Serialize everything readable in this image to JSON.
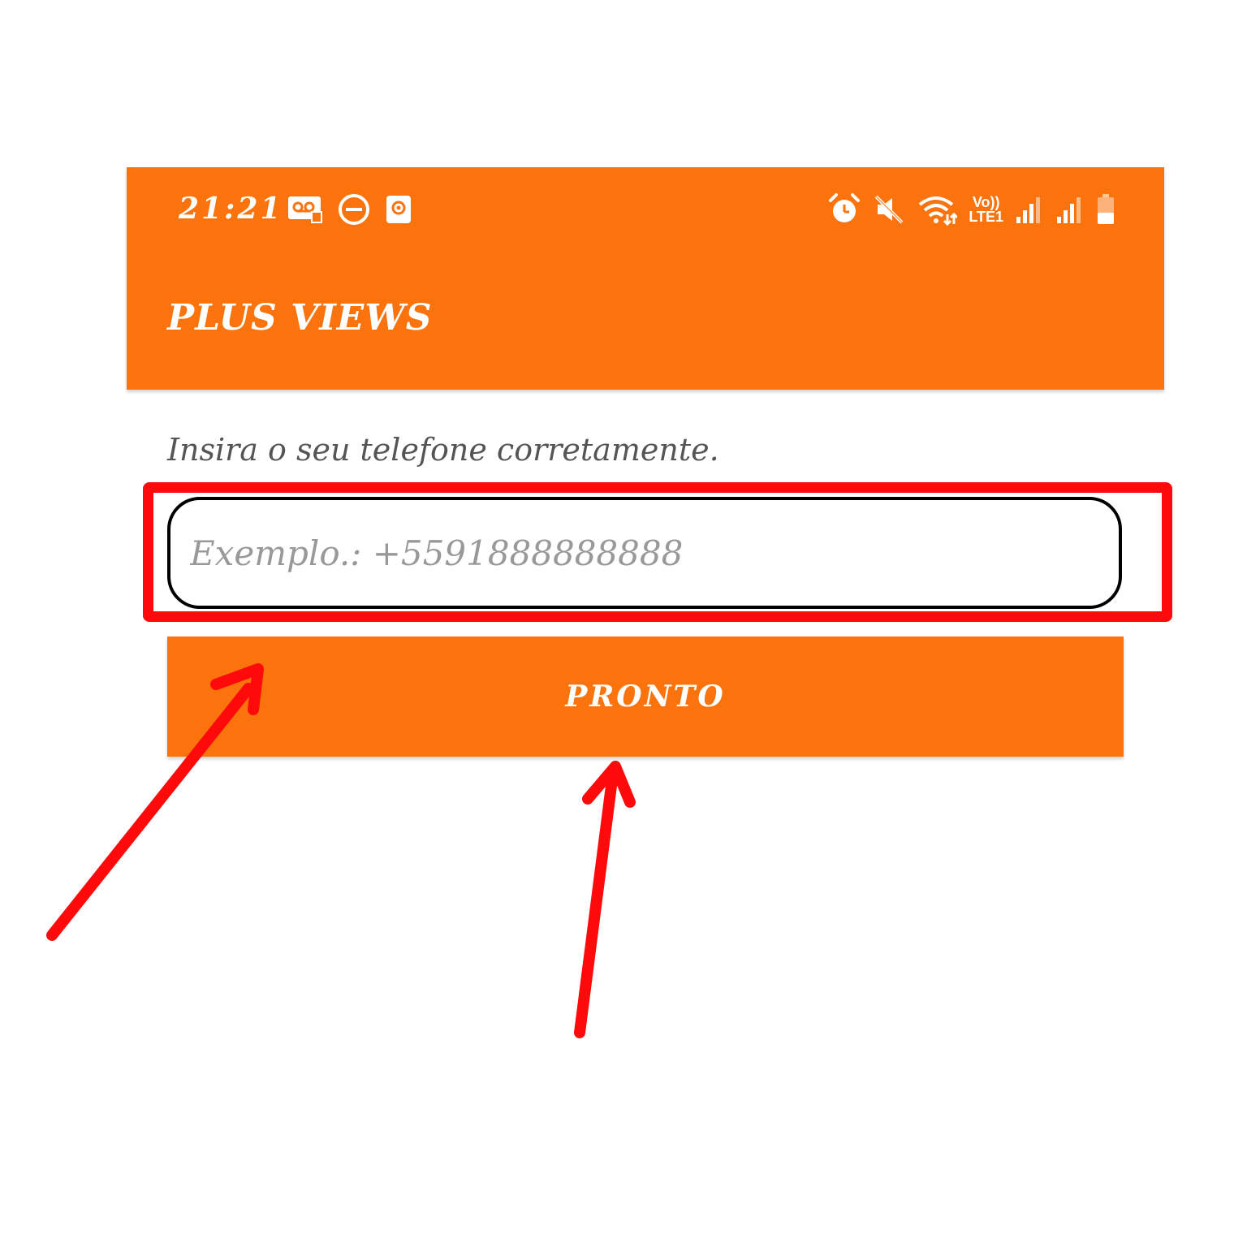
{
  "status_bar": {
    "time": "21:21",
    "network_label_top": "Vo))",
    "network_label_bottom": "LTE1",
    "left_icons": [
      "voicemail-icon",
      "do-not-disturb-icon",
      "screen-record-icon"
    ],
    "right_icons": [
      "alarm-icon",
      "mute-icon",
      "wifi-icon",
      "volte-icon",
      "signal-icon",
      "signal-icon",
      "battery-icon"
    ]
  },
  "app_bar": {
    "title": "PLUS VIEWS"
  },
  "form": {
    "instruction": "Insira o seu telefone corretamente.",
    "phone_placeholder": "Exemplo.: +5591888888888",
    "phone_value": "",
    "submit_label": "PRONTO"
  },
  "colors": {
    "accent": "#fa730c",
    "annotation": "#ff0a0a",
    "instruction_text": "#555555",
    "placeholder_text": "#999999"
  },
  "annotations": {
    "highlight": "highlight-box",
    "arrows": [
      "arrow-pointer",
      "arrow-pointer"
    ]
  }
}
